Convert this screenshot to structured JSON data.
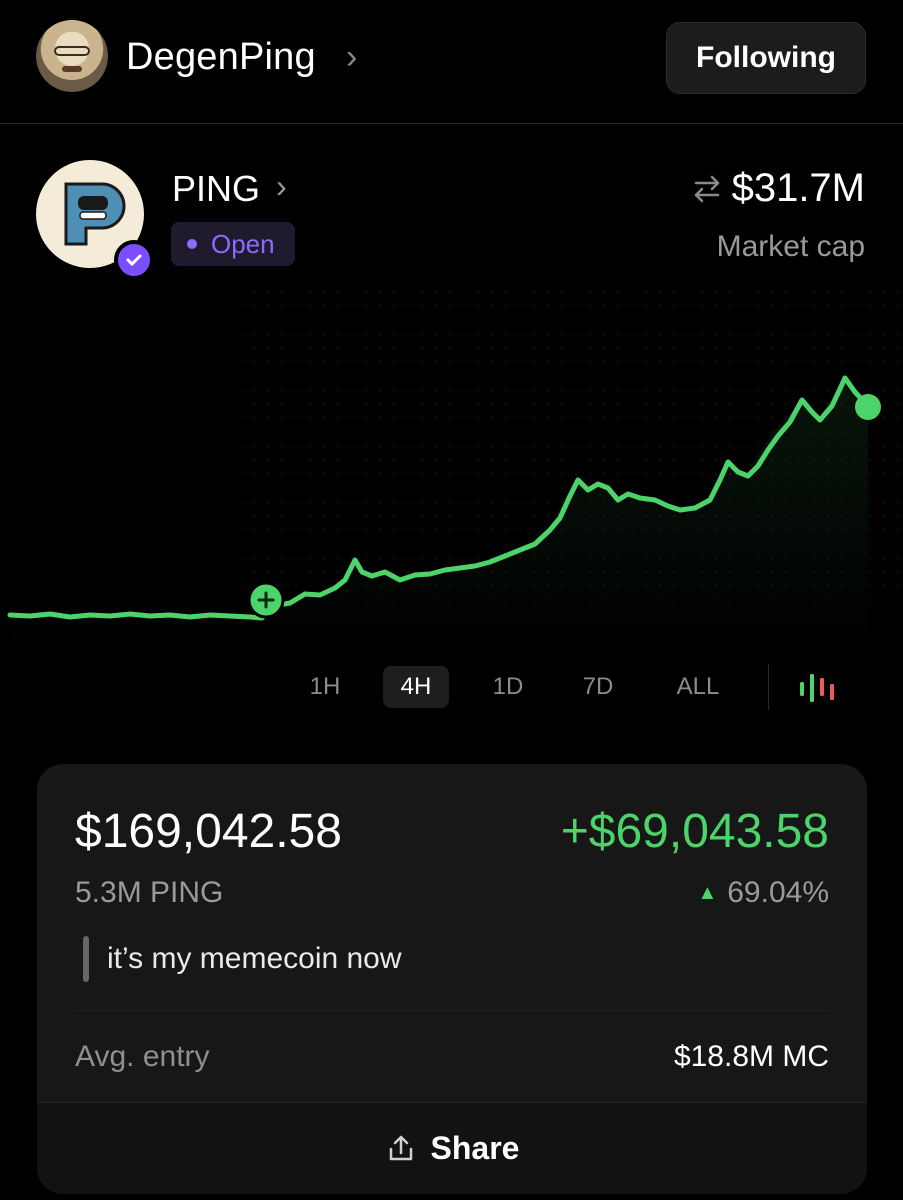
{
  "header": {
    "username": "DegenPing",
    "follow_label": "Following"
  },
  "token": {
    "symbol": "PING",
    "status": "Open",
    "market_cap": "$31.7M",
    "market_cap_label": "Market cap"
  },
  "colors": {
    "accent_green": "#4cd46a",
    "accent_purple": "#8b6cff",
    "background": "#000000",
    "card": "#171717"
  },
  "timeframes": [
    {
      "label": "1H",
      "active": false
    },
    {
      "label": "4H",
      "active": true
    },
    {
      "label": "1D",
      "active": false
    },
    {
      "label": "7D",
      "active": false
    },
    {
      "label": "ALL",
      "active": false
    }
  ],
  "position": {
    "value": "$169,042.58",
    "pnl": "+$69,043.58",
    "quantity": "5.3M PING",
    "pnl_percent": "69.04%",
    "note": "it’s my memecoin now",
    "avg_entry_label": "Avg. entry",
    "avg_entry_value": "$18.8M MC",
    "share_label": "Share"
  },
  "icons": {
    "user_chevron": "chevron-right-icon",
    "token_chevron": "chevron-right-icon",
    "swap": "swap-arrows-icon",
    "chart_type": "candlestick-icon",
    "share": "share-icon",
    "entry_marker": "plus-icon",
    "verified": "check-badge-icon"
  }
}
